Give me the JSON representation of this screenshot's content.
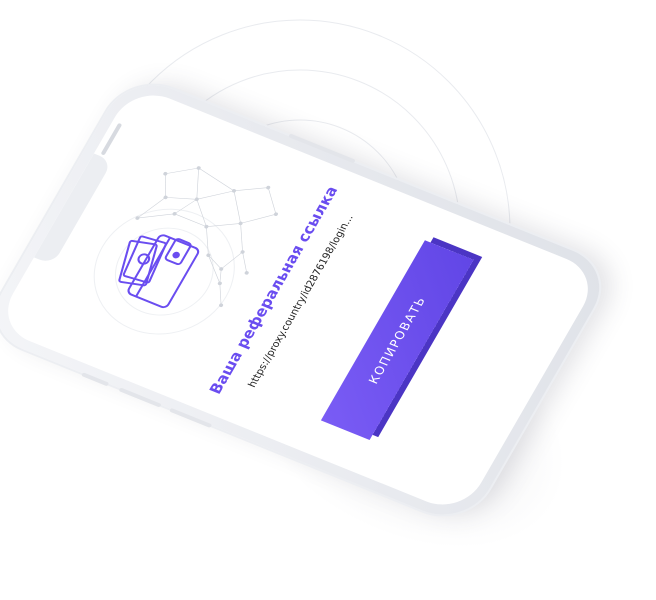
{
  "referral": {
    "title": "Ваша реферальная ссылка",
    "link": "https://proxy.country/id2876198/login...",
    "copy_button_label": "КОПИРОВАТЬ"
  },
  "colors": {
    "accent": "#6a4df0",
    "button": "#6b50ee",
    "button_shadow": "#4b35c4",
    "text": "#222222",
    "phone_frame": "#eceef2"
  },
  "icons": {
    "illustration": "wallet-with-cash-icon",
    "network": "network-mesh-decoration"
  }
}
